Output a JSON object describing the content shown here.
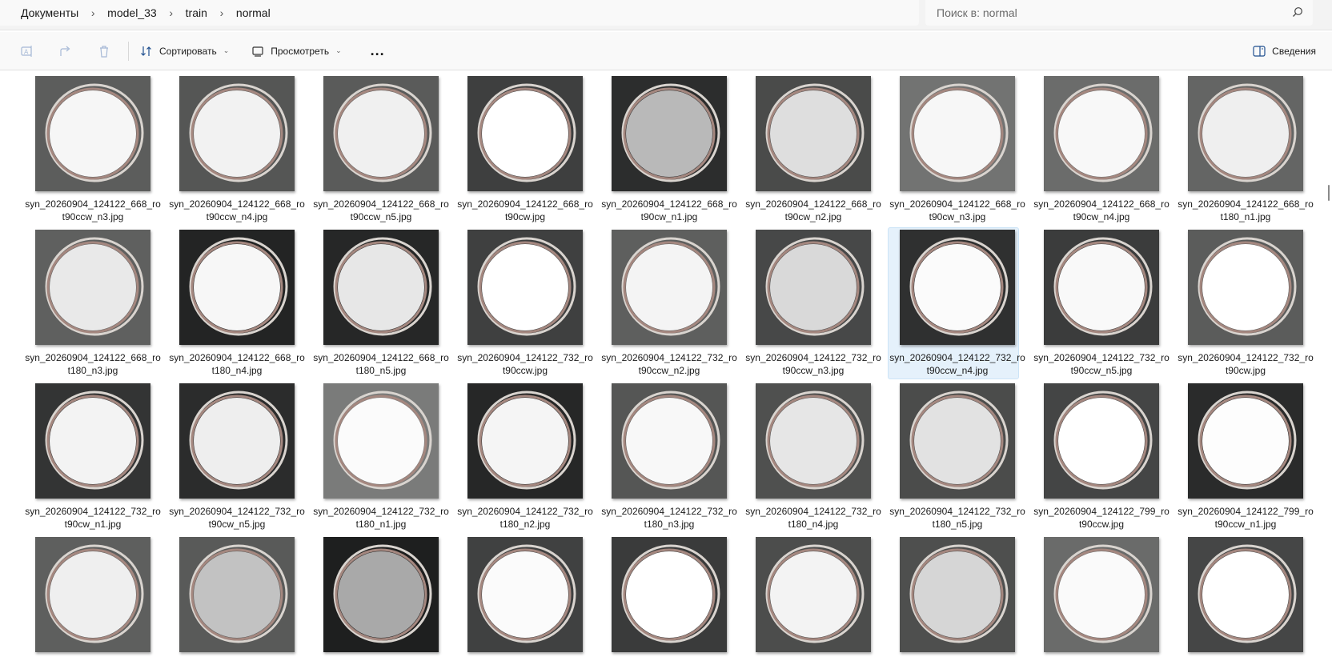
{
  "breadcrumb": [
    "Документы",
    "model_33",
    "train",
    "normal"
  ],
  "search": {
    "placeholder": "Поиск в: normal"
  },
  "toolbar": {
    "sort_label": "Сортировать",
    "view_label": "Просмотреть",
    "more_label": "...",
    "details_label": "Сведения"
  },
  "files": [
    {
      "l1": "syn_20260904_124122_668_ro",
      "l2": "t90ccw_n3.jpg",
      "bg": "#5c5d5c",
      "disc": "#f6f6f6"
    },
    {
      "l1": "syn_20260904_124122_668_ro",
      "l2": "t90ccw_n4.jpg",
      "bg": "#555655",
      "disc": "#f2f2f2"
    },
    {
      "l1": "syn_20260904_124122_668_ro",
      "l2": "t90ccw_n5.jpg",
      "bg": "#5a5b5a",
      "disc": "#f0f0f0"
    },
    {
      "l1": "syn_20260904_124122_668_ro",
      "l2": "t90cw.jpg",
      "bg": "#3e3f3f",
      "disc": "#ffffff"
    },
    {
      "l1": "syn_20260904_124122_668_ro",
      "l2": "t90cw_n1.jpg",
      "bg": "#2c2d2d",
      "disc": "#b9b9b9"
    },
    {
      "l1": "syn_20260904_124122_668_ro",
      "l2": "t90cw_n2.jpg",
      "bg": "#4a4b4a",
      "disc": "#dedede"
    },
    {
      "l1": "syn_20260904_124122_668_ro",
      "l2": "t90cw_n3.jpg",
      "bg": "#727372",
      "disc": "#f7f7f7"
    },
    {
      "l1": "syn_20260904_124122_668_ro",
      "l2": "t90cw_n4.jpg",
      "bg": "#6b6c6b",
      "disc": "#f8f8f8"
    },
    {
      "l1": "syn_20260904_124122_668_ro",
      "l2": "t180_n1.jpg",
      "bg": "#646564",
      "disc": "#efefef"
    },
    {
      "l1": "syn_20260904_124122_668_ro",
      "l2": "t180_n3.jpg",
      "bg": "#5f605f",
      "disc": "#e9e9e9"
    },
    {
      "l1": "syn_20260904_124122_668_ro",
      "l2": "t180_n4.jpg",
      "bg": "#232424",
      "disc": "#f7f7f7"
    },
    {
      "l1": "syn_20260904_124122_668_ro",
      "l2": "t180_n5.jpg",
      "bg": "#262727",
      "disc": "#e7e7e7"
    },
    {
      "l1": "syn_20260904_124122_732_ro",
      "l2": "t90ccw.jpg",
      "bg": "#3f4040",
      "disc": "#ffffff"
    },
    {
      "l1": "syn_20260904_124122_732_ro",
      "l2": "t90ccw_n2.jpg",
      "bg": "#5e5f5e",
      "disc": "#f4f4f4"
    },
    {
      "l1": "syn_20260904_124122_732_ro",
      "l2": "t90ccw_n3.jpg",
      "bg": "#474848",
      "disc": "#d9d9d9"
    },
    {
      "l1": "syn_20260904_124122_732_ro",
      "l2": "t90ccw_n4.jpg",
      "bg": "#2f3030",
      "disc": "#fbfbfb",
      "selected": true
    },
    {
      "l1": "syn_20260904_124122_732_ro",
      "l2": "t90ccw_n5.jpg",
      "bg": "#3b3c3c",
      "disc": "#f9f9f9"
    },
    {
      "l1": "syn_20260904_124122_732_ro",
      "l2": "t90cw.jpg",
      "bg": "#5b5c5b",
      "disc": "#ffffff"
    },
    {
      "l1": "syn_20260904_124122_732_ro",
      "l2": "t90cw_n1.jpg",
      "bg": "#333434",
      "disc": "#f3f3f3"
    },
    {
      "l1": "syn_20260904_124122_732_ro",
      "l2": "t90cw_n5.jpg",
      "bg": "#2b2c2c",
      "disc": "#eeeeee"
    },
    {
      "l1": "syn_20260904_124122_732_ro",
      "l2": "t180_n1.jpg",
      "bg": "#7a7b7a",
      "disc": "#fbfbfb"
    },
    {
      "l1": "syn_20260904_124122_732_ro",
      "l2": "t180_n2.jpg",
      "bg": "#262727",
      "disc": "#f5f5f5"
    },
    {
      "l1": "syn_20260904_124122_732_ro",
      "l2": "t180_n3.jpg",
      "bg": "#555655",
      "disc": "#f8f8f8"
    },
    {
      "l1": "syn_20260904_124122_732_ro",
      "l2": "t180_n4.jpg",
      "bg": "#4f504f",
      "disc": "#e6e6e6"
    },
    {
      "l1": "syn_20260904_124122_732_ro",
      "l2": "t180_n5.jpg",
      "bg": "#4b4c4b",
      "disc": "#e2e2e2"
    },
    {
      "l1": "syn_20260904_124122_799_ro",
      "l2": "t90ccw.jpg",
      "bg": "#444545",
      "disc": "#ffffff"
    },
    {
      "l1": "syn_20260904_124122_799_ro",
      "l2": "t90ccw_n1.jpg",
      "bg": "#2a2b2b",
      "disc": "#fdfdfd"
    },
    {
      "l1": "",
      "l2": "",
      "bg": "#5e5f5e",
      "disc": "#efefef"
    },
    {
      "l1": "",
      "l2": "",
      "bg": "#595a59",
      "disc": "#c2c2c2"
    },
    {
      "l1": "",
      "l2": "",
      "bg": "#1e1f1f",
      "disc": "#a9a9a9"
    },
    {
      "l1": "",
      "l2": "",
      "bg": "#404141",
      "disc": "#fbfbfb"
    },
    {
      "l1": "",
      "l2": "",
      "bg": "#3a3b3b",
      "disc": "#ffffff"
    },
    {
      "l1": "",
      "l2": "",
      "bg": "#4c4d4c",
      "disc": "#f3f3f3"
    },
    {
      "l1": "",
      "l2": "",
      "bg": "#4e4f4e",
      "disc": "#d6d6d6"
    },
    {
      "l1": "",
      "l2": "",
      "bg": "#6a6b6a",
      "disc": "#fafafa"
    },
    {
      "l1": "",
      "l2": "",
      "bg": "#454646",
      "disc": "#ffffff"
    }
  ]
}
